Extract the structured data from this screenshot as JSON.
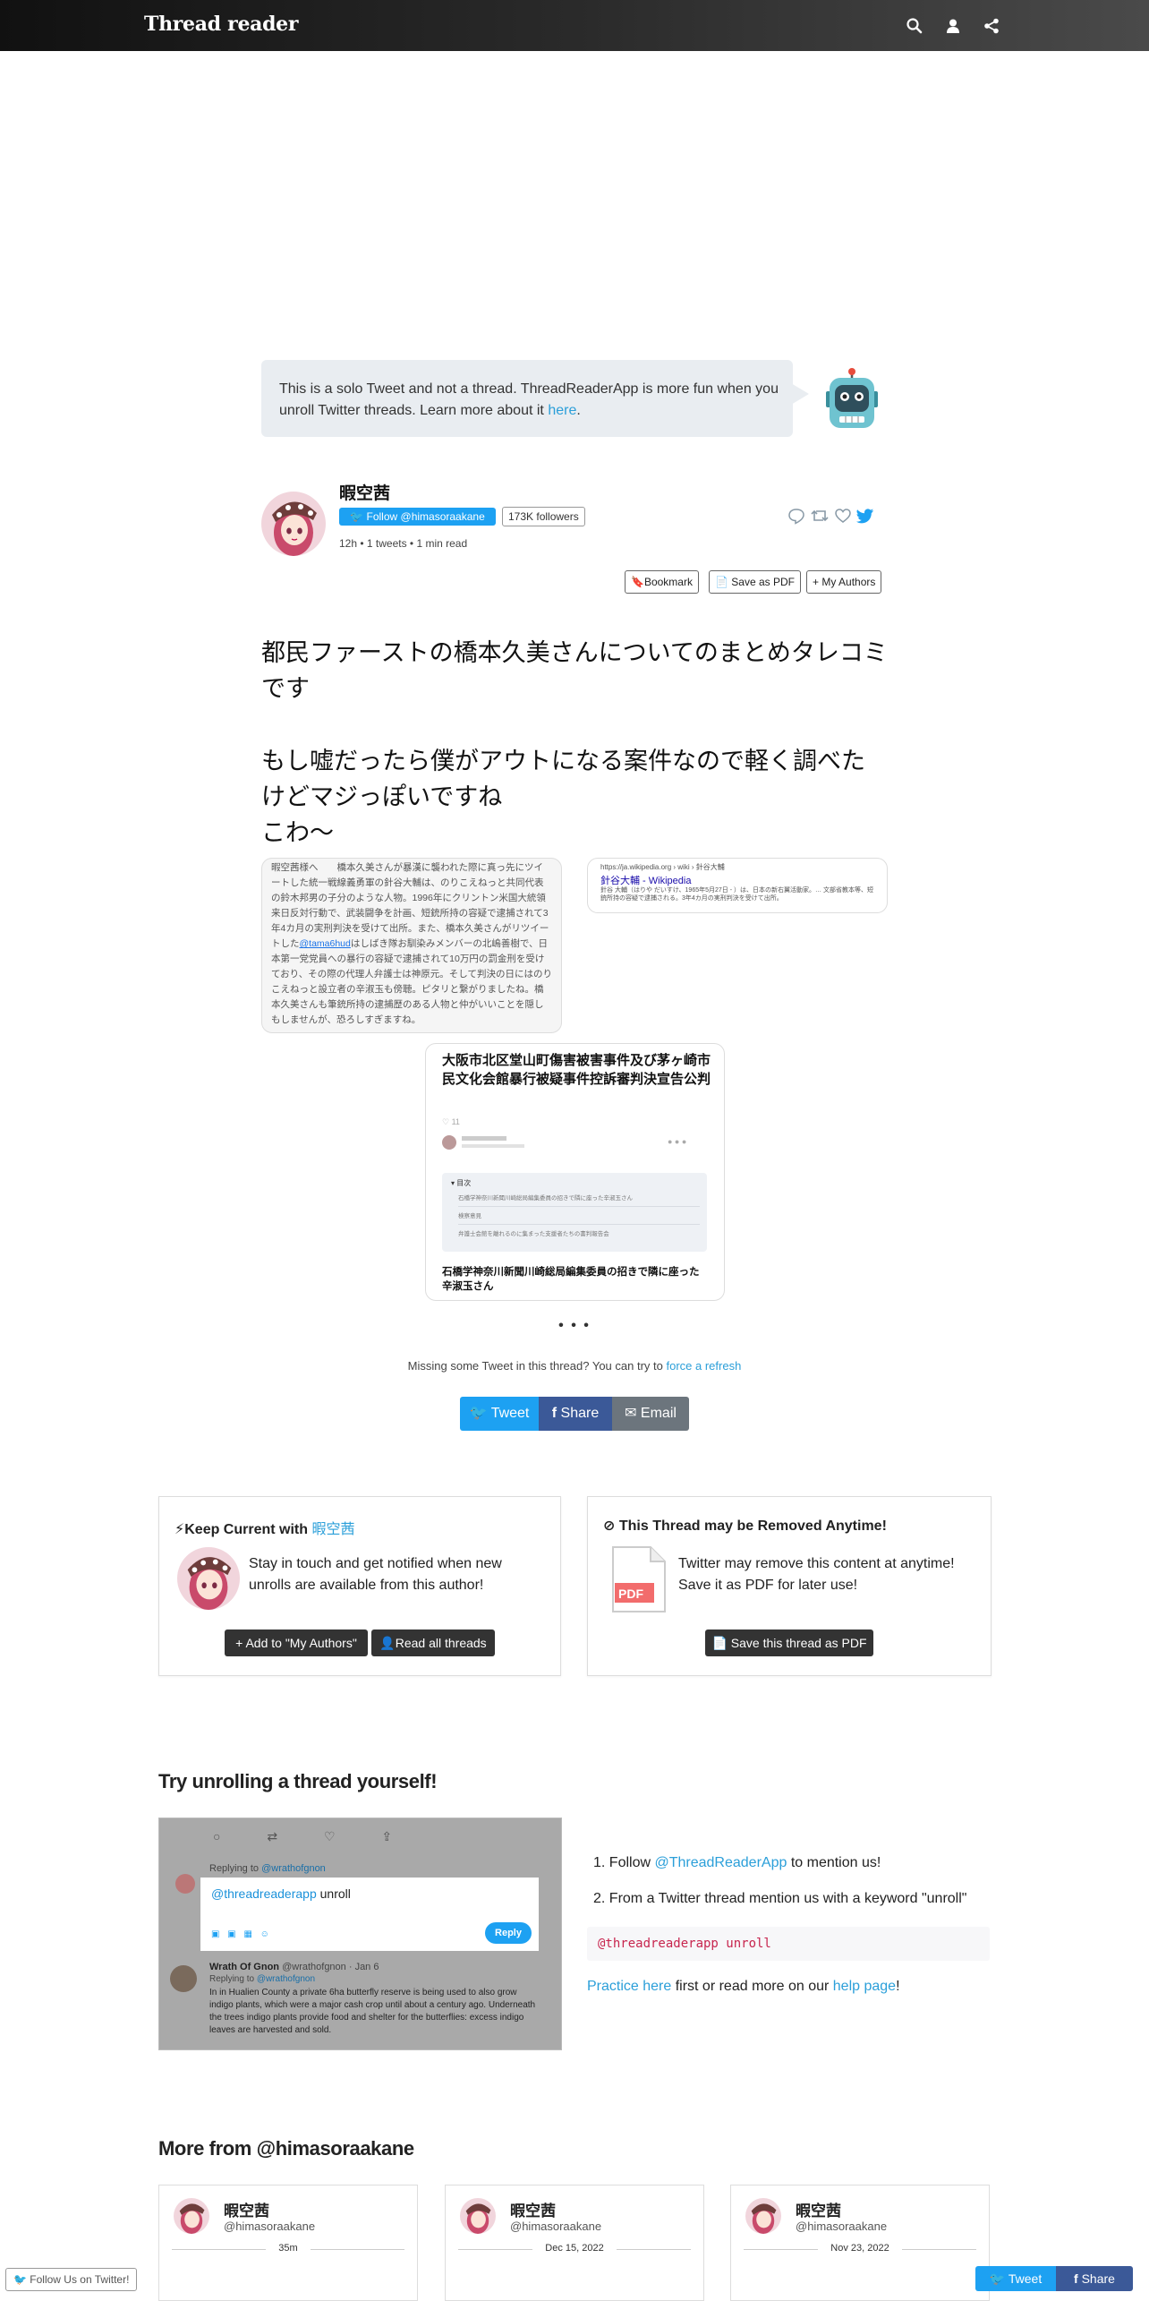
{
  "header": {
    "logo": "Thread reader",
    "icons": [
      "search-icon",
      "user-icon",
      "share-icon"
    ]
  },
  "notice": {
    "text": "This is a solo Tweet and not a thread. ThreadReaderApp is more fun when you unroll Twitter threads. Learn more about it ",
    "link": "here",
    "end": "."
  },
  "author": {
    "name": "暇空茜",
    "follow_label": "Follow @himasoraakane",
    "followers": "173K followers",
    "meta": "12h • 1 tweets • 1 min read"
  },
  "actions": {
    "bookmark": "Bookmark",
    "save_pdf": "Save as PDF",
    "my_authors": "My Authors"
  },
  "tweet": {
    "line1": "都民ファーストの橋本久美さんについてのまとめタレコミです",
    "line2": "もし嘘だったら僕がアウトになる案件なので軽く調べたけどマジっぽいですね",
    "line3": "こわ～"
  },
  "media": {
    "screenshot_text": "暇空茜様へ　　橋本久美さんが暴漢に襲われた際に真っ先にツイートした統一戦線義勇軍の針谷大輔は、のりこえねっと共同代表の鈴木邦男の子分のような人物。1996年にクリントン米国大統領来日反対行動で、武装闘争を計画、短銃所持の容疑で逮捕されて3年4カ月の実刑判決を受けて出所。また、橋本久美さんがリツイートした",
    "screenshot_mention": "@tama6hud",
    "screenshot_text2": "はしばき隊お馴染みメンバーの北嶋善樹で、日本第一党党員への暴行の容疑で逮捕されて10万円の罰金刑を受けており、その際の代理人弁護士は神原元。そして判決の日にはのりこえねっと設立者の辛淑玉も傍聴。ピタリと繋がりましたね。橋本久美さんも筆銃所持の逮捕歴のある人物と仲がいいことを隠しもしませんが、恐ろしすぎますね。",
    "wiki_url": "https://ja.wikipedia.org › wiki › 針谷大輔",
    "wiki_title": "針谷大輔 - Wikipedia",
    "wiki_snippet": "針谷 大輔（はりや だいすけ、1965年5月27日 - ）は、日本の新右翼活動家。… 文部省教本等、短銃所持の容疑で逮捕される。3年4カ月の実刑判決を受けて出所。",
    "article_title": "大阪市北区堂山町傷害被害事件及び茅ヶ崎市民文化会館暴行被疑事件控訴審判決宣告公判",
    "article_likes": "♡ 11",
    "article_toc_head": "▾ 目次",
    "article_toc": [
      "石橋学神奈川新聞川崎総局編集委員の招きで隣に座った辛淑玉さん",
      "検察意見",
      "弁護士会館を離れるのに集まった支援者たちの書判報告会"
    ],
    "article_subtitle": "石橋学神奈川新聞川崎総局編集委員の招きで隣に座った辛淑玉さん"
  },
  "ellipsis": "• • •",
  "missing": {
    "text": "Missing some Tweet in this thread? You can try to ",
    "link": "force a refresh"
  },
  "share_buttons": {
    "tweet": "Tweet",
    "share": "Share",
    "email": "Email"
  },
  "keep_current": {
    "title": "Keep Current with ",
    "author": "暇空茜",
    "body": "Stay in touch and get notified when new unrolls are available from this author!",
    "add_btn": "Add to \"My Authors\"",
    "read_btn": "Read all threads"
  },
  "removed": {
    "title": "This Thread may be Removed Anytime!",
    "body": "Twitter may remove this content at anytime! Save it as PDF for later use!",
    "pdf_label": "PDF",
    "save_btn": "Save this thread as PDF"
  },
  "try": {
    "title": "Try unrolling a thread yourself!",
    "step1_pre": "Follow ",
    "step1_link": "@ThreadReaderApp",
    "step1_post": " to mention us!",
    "step2": "From a Twitter thread mention us with a keyword \"unroll\"",
    "code": "@threadreaderapp unroll",
    "practice_link": "Practice here",
    "practice_mid": " first or read more on our ",
    "help_link": "help page",
    "practice_end": "!"
  },
  "demo": {
    "replying": "Replying to ",
    "replying_handle": "@wrathofgnon",
    "input_mention": "@threadreaderapp",
    "input_word": " unroll",
    "reply_btn": "Reply",
    "author": "Wrath Of Gnon",
    "author_meta": "@wrathofgnon · Jan 6",
    "replying2": "Replying to ",
    "replying2_handle": "@wrathofgnon",
    "body": "In in Hualien County a private 6ha butterfly reserve is being used to also grow indigo plants, which were a major cash crop until about a century ago. Underneath the trees indigo plants provide food and shelter for the butterflies: excess indigo leaves are harvested and sold."
  },
  "more": {
    "title": "More from @himasoraakane",
    "cards": [
      {
        "name": "暇空茜",
        "handle": "@himasoraakane",
        "date": "35m"
      },
      {
        "name": "暇空茜",
        "handle": "@himasoraakane",
        "date": "Dec 15, 2022"
      },
      {
        "name": "暇空茜",
        "handle": "@himasoraakane",
        "date": "Nov 23, 2022"
      }
    ]
  },
  "footer": {
    "follow_twitter": "Follow Us on Twitter!",
    "tweet": "Tweet",
    "share": "Share"
  }
}
